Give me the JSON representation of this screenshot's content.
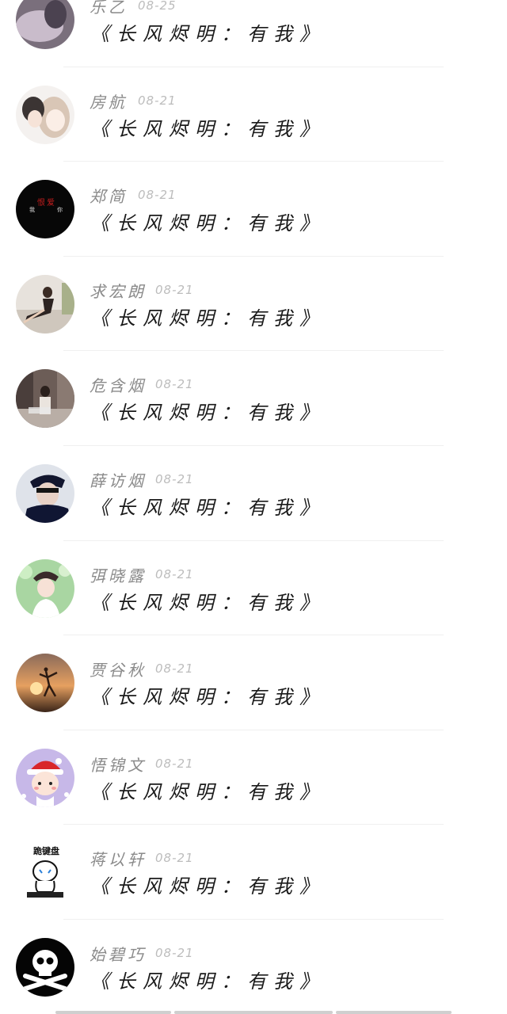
{
  "comments": [
    {
      "name": "乐乙",
      "date": "08-25",
      "message": "《长风烬明：有我》",
      "avatar_icon": "photo-avatar-icon"
    },
    {
      "name": "房航",
      "date": "08-21",
      "message": "《长风烬明：有我》",
      "avatar_icon": "anime-couple-avatar-icon"
    },
    {
      "name": "郑简",
      "date": "08-21",
      "message": "《长风烬明：有我》",
      "avatar_icon": "text-avatar-icon"
    },
    {
      "name": "求宏朗",
      "date": "08-21",
      "message": "《长风烬明：有我》",
      "avatar_icon": "girl-photo-avatar-icon"
    },
    {
      "name": "危含烟",
      "date": "08-21",
      "message": "《长风烬明：有我》",
      "avatar_icon": "street-photo-avatar-icon"
    },
    {
      "name": "薛访烟",
      "date": "08-21",
      "message": "《长风烬明：有我》",
      "avatar_icon": "man-hat-avatar-icon"
    },
    {
      "name": "弭晓露",
      "date": "08-21",
      "message": "《长风烬明：有我》",
      "avatar_icon": "girl-green-avatar-icon"
    },
    {
      "name": "贾谷秋",
      "date": "08-21",
      "message": "《长风烬明：有我》",
      "avatar_icon": "sunset-dancer-avatar-icon"
    },
    {
      "name": "悟锦文",
      "date": "08-21",
      "message": "《长风烬明：有我》",
      "avatar_icon": "cartoon-santa-avatar-icon"
    },
    {
      "name": "蒋以轩",
      "date": "08-21",
      "message": "《长风烬明：有我》",
      "avatar_icon": "kneel-keyboard-avatar-icon",
      "avatar_text": "跪键盘"
    },
    {
      "name": "始碧巧",
      "date": "08-21",
      "message": "《长风烬明：有我》",
      "avatar_icon": "skull-avatar-icon"
    }
  ],
  "avatar3_text": [
    "我",
    "恨",
    "爱",
    "你"
  ]
}
